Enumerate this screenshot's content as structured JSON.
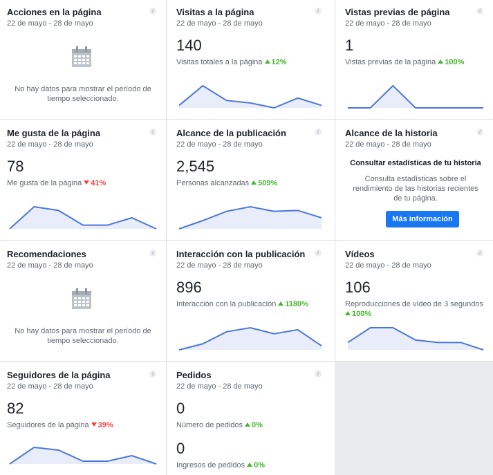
{
  "cards": {
    "acciones": {
      "title": "Acciones en la página",
      "date": "22 de mayo - 28 de mayo",
      "nodata_line1": "No hay datos para mostrar el período de",
      "nodata_line2": "tiempo seleccionado."
    },
    "visitas": {
      "title": "Visitas a la página",
      "date": "22 de mayo - 28 de mayo",
      "value": "140",
      "label": "Visitas totales a la página",
      "change": "12%",
      "trend": "up",
      "series": [
        2,
        10,
        4,
        3,
        1,
        5,
        2
      ]
    },
    "vistas": {
      "title": "Vistas previas de página",
      "date": "22 de mayo - 28 de mayo",
      "value": "1",
      "label": "Vistas previas de la página",
      "change": "100%",
      "trend": "up",
      "series": [
        0,
        0,
        1,
        0,
        0,
        0,
        0
      ]
    },
    "megusta": {
      "title": "Me gusta de la página",
      "date": "22 de mayo - 28 de mayo",
      "value": "78",
      "label": "Me gusta de la página",
      "change": "41%",
      "trend": "down",
      "series": [
        2,
        8,
        7,
        3,
        3,
        5,
        2
      ]
    },
    "alcance": {
      "title": "Alcance de la publicación",
      "date": "22 de mayo - 28 de mayo",
      "value": "2,545",
      "label": "Personas alcanzadas",
      "change": "509%",
      "trend": "up",
      "series": [
        3,
        12,
        22,
        27,
        22,
        23,
        15
      ]
    },
    "historia": {
      "title": "Alcance de la historia",
      "date": "22 de mayo - 28 de mayo",
      "heading": "Consultar estadísticas de tu historia",
      "text": "Consulta estadísticas sobre el rendimiento de las historias recientes de tu página.",
      "button": "Más información"
    },
    "recomendaciones": {
      "title": "Recomendaciones",
      "date": "22 de mayo - 28 de mayo",
      "nodata_line1": "No hay datos para mostrar el período de",
      "nodata_line2": "tiempo seleccionado."
    },
    "interaccion": {
      "title": "Interacción con la publicación",
      "date": "22 de mayo - 28 de mayo",
      "value": "896",
      "label": "Interacción con la publicación",
      "change": "1180%",
      "trend": "up",
      "series": [
        4,
        7,
        13,
        15,
        12,
        14,
        6
      ]
    },
    "videos": {
      "title": "Vídeos",
      "date": "22 de mayo - 28 de mayo",
      "value": "106",
      "label": "Reproducciones de vídeo de 3 segundos",
      "change": "100%",
      "trend": "up",
      "series": [
        4,
        10,
        10,
        5,
        4,
        4,
        1
      ]
    },
    "seguidores": {
      "title": "Seguidores de la página",
      "date": "22 de mayo - 28 de mayo",
      "value": "82",
      "label": "Seguidores de la página",
      "change": "39%",
      "trend": "down",
      "series": [
        2,
        8,
        7,
        3,
        3,
        5,
        2
      ]
    },
    "pedidos": {
      "title": "Pedidos",
      "date": "22 de mayo - 28 de mayo",
      "value1": "0",
      "label1": "Número de pedidos",
      "change1": "0%",
      "value2": "0",
      "label2": "Ingresos de pedidos",
      "change2": "0%"
    }
  },
  "colors": {
    "line": "#4a76dc",
    "fill": "#e8edf9",
    "up": "#42b72a",
    "down": "#fa3e3e",
    "button": "#1877f2"
  },
  "icons": {
    "info": "info-icon",
    "calendar": "calendar-icon"
  },
  "info_glyph": "i"
}
